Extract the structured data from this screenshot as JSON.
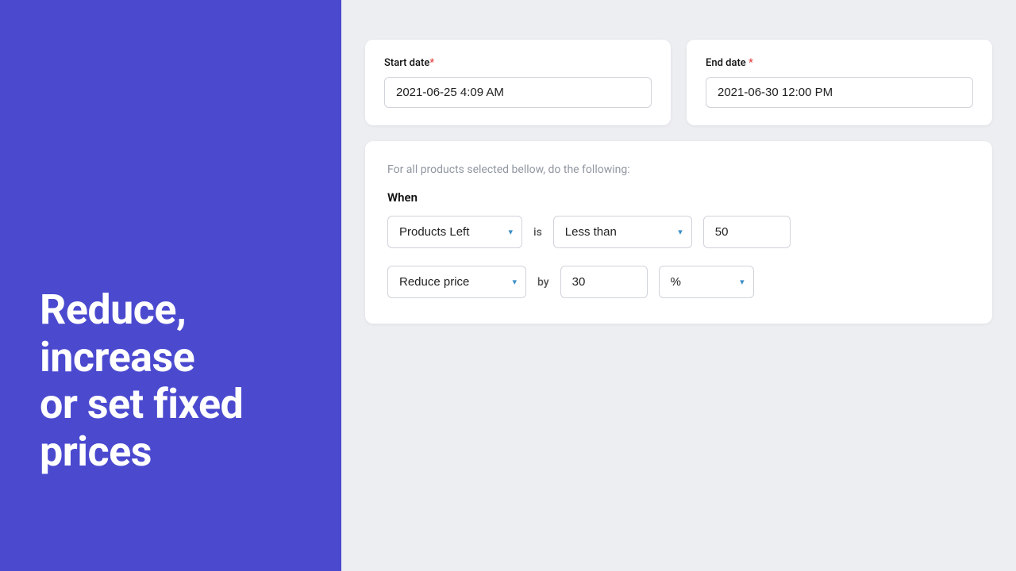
{
  "left": {
    "hero_line1": "Reduce,",
    "hero_line2": "increase",
    "hero_line3": "or set fixed",
    "hero_line4": "prices"
  },
  "right": {
    "start_date": {
      "label": "Start date",
      "required": "*",
      "value": "2021-06-25 4:09 AM"
    },
    "end_date": {
      "label": "End date ",
      "required": "*",
      "value": "2021-06-30 12:00 PM"
    },
    "rules": {
      "description": "For all products selected bellow, do the following:",
      "when_label": "When",
      "condition_field_value": "Products Left",
      "connector_is": "is",
      "condition_type_value": "Less than",
      "condition_number": "50",
      "action_field_value": "Reduce price",
      "connector_by": "by",
      "action_number": "30",
      "action_unit_value": "%"
    }
  },
  "icons": {
    "chevron_down": "▾"
  }
}
